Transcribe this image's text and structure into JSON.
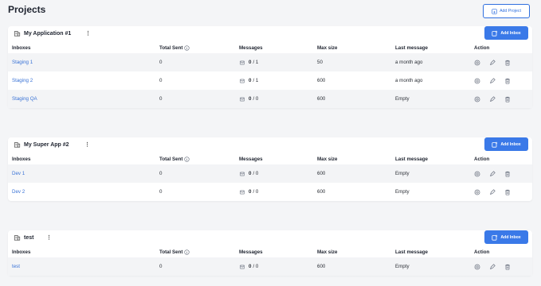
{
  "page": {
    "title": "Projects",
    "add_project_label": "Add Project"
  },
  "columns": {
    "inboxes": "Inboxes",
    "total_sent": "Total Sent",
    "messages": "Messages",
    "max_size": "Max size",
    "last_message": "Last message",
    "action": "Action"
  },
  "add_inbox_label": "Add Inbox",
  "projects": [
    {
      "name": "My Application #1",
      "inboxes": [
        {
          "name": "Staging 1",
          "total_sent": "0",
          "messages_count": "0",
          "messages_total": "/ 1",
          "max_size": "50",
          "last_message": "a month ago"
        },
        {
          "name": "Staging 2",
          "total_sent": "0",
          "messages_count": "0",
          "messages_total": "/ 1",
          "max_size": "600",
          "last_message": "a month ago"
        },
        {
          "name": "Staging QA",
          "total_sent": "0",
          "messages_count": "0",
          "messages_total": "/ 0",
          "max_size": "600",
          "last_message": "Empty"
        }
      ]
    },
    {
      "name": "My Super App #2",
      "inboxes": [
        {
          "name": "Dev 1",
          "total_sent": "0",
          "messages_count": "0",
          "messages_total": "/ 0",
          "max_size": "600",
          "last_message": "Empty"
        },
        {
          "name": "Dev 2",
          "total_sent": "0",
          "messages_count": "0",
          "messages_total": "/ 0",
          "max_size": "600",
          "last_message": "Empty"
        }
      ]
    },
    {
      "name": "test",
      "inboxes": [
        {
          "name": "test",
          "total_sent": "0",
          "messages_count": "0",
          "messages_total": "/ 0",
          "max_size": "600",
          "last_message": "Empty"
        }
      ]
    }
  ],
  "colors": {
    "accent": "#3a79e8",
    "link": "#3a73d6",
    "row_alt": "#f3f4f6",
    "background": "#f4f5f7"
  },
  "icons": {
    "project": "building-icon",
    "info": "info-circle-icon",
    "mail": "envelope-icon",
    "settings": "gear-icon",
    "edit": "pencil-icon",
    "delete": "trash-icon",
    "add_inbox": "inbox-plus-icon"
  }
}
